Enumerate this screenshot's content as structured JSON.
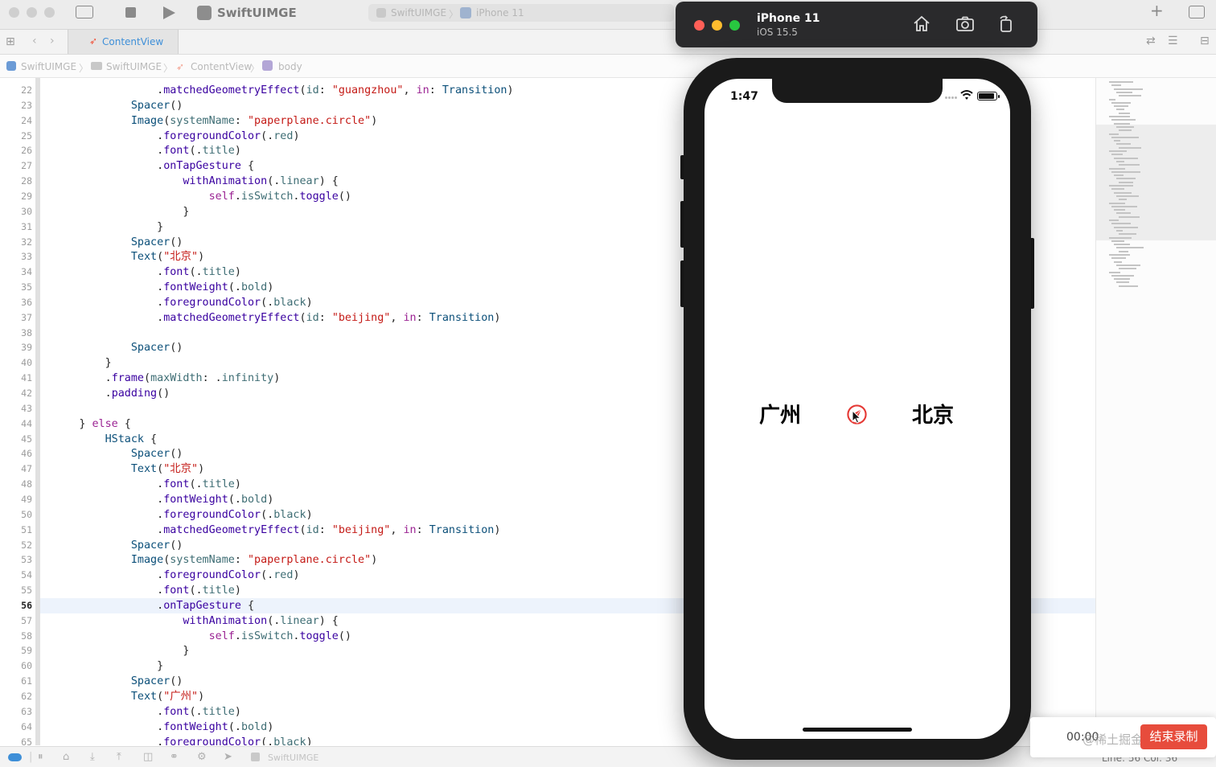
{
  "toolbar": {
    "scheme": "SwiftUIMGE",
    "run_destination_scheme": "SwiftUIMGE",
    "run_destination_device": "iPhone 11"
  },
  "tabs": [
    {
      "label": "ContentView"
    }
  ],
  "breadcrumb": [
    "SwiftUIMGE",
    "SwiftUIMGE",
    "ContentView",
    "body"
  ],
  "editor": {
    "current_line": 56,
    "lines": [
      {
        "n": "22",
        "code": "                .matchedGeometryEffect(id: \"guangzhou\", in: Transition)"
      },
      {
        "n": "23",
        "code": "            Spacer()"
      },
      {
        "n": "24",
        "code": "            Image(systemName: \"paperplane.circle\")"
      },
      {
        "n": "25",
        "code": "                .foregroundColor(.red)"
      },
      {
        "n": "26",
        "code": "                .font(.title)"
      },
      {
        "n": "27",
        "code": "                .onTapGesture {"
      },
      {
        "n": "28",
        "code": "                    withAnimation(.linear) {"
      },
      {
        "n": "29",
        "code": "                        self.isSwitch.toggle()"
      },
      {
        "n": "30",
        "code": "                    }"
      },
      {
        "n": "31",
        "code": "                }"
      },
      {
        "n": "32",
        "code": "            Spacer()"
      },
      {
        "n": "33",
        "code": "            Text(\"北京\")"
      },
      {
        "n": "34",
        "code": "                .font(.title)"
      },
      {
        "n": "35",
        "code": "                .fontWeight(.bold)"
      },
      {
        "n": "36",
        "code": "                .foregroundColor(.black)"
      },
      {
        "n": "37",
        "code": "                .matchedGeometryEffect(id: \"beijing\", in: Transition)"
      },
      {
        "n": "38",
        "code": ""
      },
      {
        "n": "39",
        "code": "            Spacer()"
      },
      {
        "n": "40",
        "code": "        }"
      },
      {
        "n": "41",
        "code": "        .frame(maxWidth: .infinity)"
      },
      {
        "n": "42",
        "code": "        .padding()"
      },
      {
        "n": "43",
        "code": ""
      },
      {
        "n": "44",
        "code": "    } else {"
      },
      {
        "n": "45",
        "code": "        HStack {"
      },
      {
        "n": "46",
        "code": "            Spacer()"
      },
      {
        "n": "47",
        "code": "            Text(\"北京\")"
      },
      {
        "n": "48",
        "code": "                .font(.title)"
      },
      {
        "n": "49",
        "code": "                .fontWeight(.bold)"
      },
      {
        "n": "50",
        "code": "                .foregroundColor(.black)"
      },
      {
        "n": "51",
        "code": "                .matchedGeometryEffect(id: \"beijing\", in: Transition)"
      },
      {
        "n": "52",
        "code": "            Spacer()"
      },
      {
        "n": "53",
        "code": "            Image(systemName: \"paperplane.circle\")"
      },
      {
        "n": "54",
        "code": "                .foregroundColor(.red)"
      },
      {
        "n": "55",
        "code": "                .font(.title)"
      },
      {
        "n": "56",
        "code": "                .onTapGesture {"
      },
      {
        "n": "57",
        "code": "                    withAnimation(.linear) {"
      },
      {
        "n": "58",
        "code": "                        self.isSwitch.toggle()"
      },
      {
        "n": "59",
        "code": "                    }"
      },
      {
        "n": "60",
        "code": "                }"
      },
      {
        "n": "61",
        "code": "            Spacer()"
      },
      {
        "n": "62",
        "code": "            Text(\"广州\")"
      },
      {
        "n": "63",
        "code": "                .font(.title)"
      },
      {
        "n": "64",
        "code": "                .fontWeight(.bold)"
      },
      {
        "n": "65",
        "code": "                .foregroundColor(.black)"
      }
    ]
  },
  "simulator": {
    "device": "iPhone 11",
    "os": "iOS 15.5",
    "status_time": "1:47",
    "left_city": "广州",
    "right_city": "北京",
    "icon_color": "#e53935"
  },
  "debugbar": {
    "scheme": "SwiftUIMGE"
  },
  "recording": {
    "time": "00:00",
    "watermark": "@稀土掘金技术社区",
    "stop_label": "结束录制"
  },
  "status": "Line: 56  Col: 36"
}
